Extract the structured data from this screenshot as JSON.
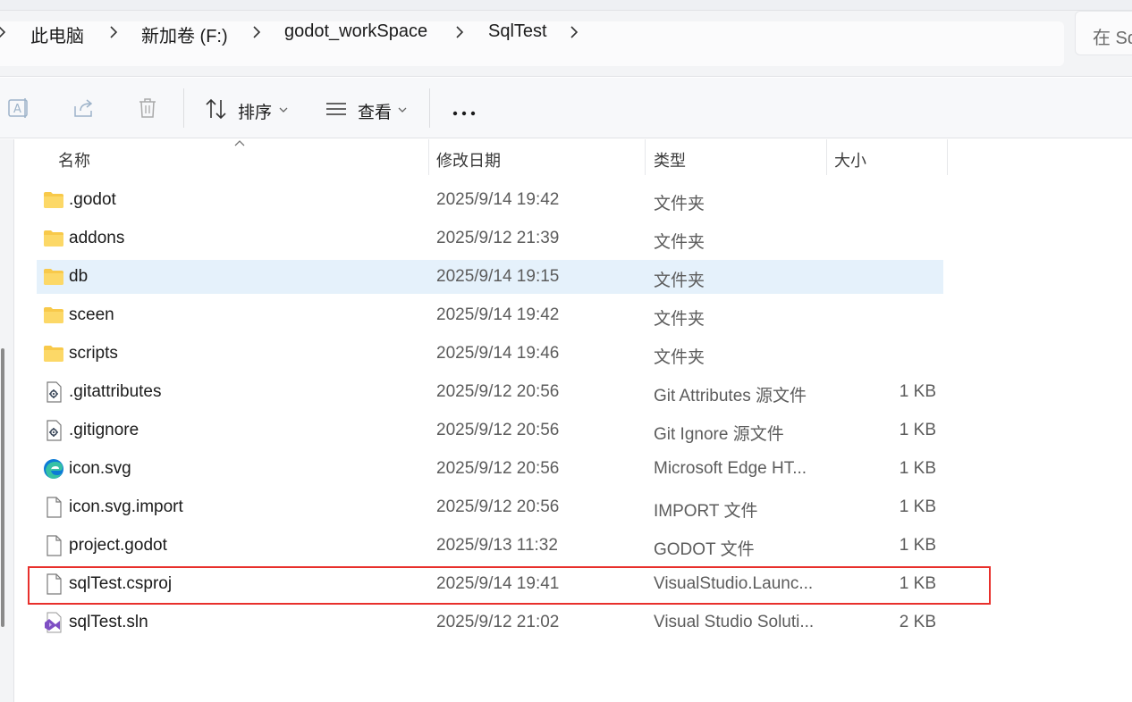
{
  "breadcrumb": {
    "items": [
      "此电脑",
      "新加卷 (F:)",
      "godot_workSpace",
      "SqlTest"
    ],
    "search_placeholder": "在 Sq"
  },
  "toolbar": {
    "sort_label": "排序",
    "view_label": "查看"
  },
  "columns": {
    "name": "名称",
    "date": "修改日期",
    "type": "类型",
    "size": "大小"
  },
  "files": [
    {
      "name": ".godot",
      "date": "2025/9/14 19:42",
      "type": "文件夹",
      "size": "",
      "icon": "folder-icon"
    },
    {
      "name": "addons",
      "date": "2025/9/12 21:39",
      "type": "文件夹",
      "size": "",
      "icon": "folder-icon"
    },
    {
      "name": "db",
      "date": "2025/9/14 19:15",
      "type": "文件夹",
      "size": "",
      "icon": "folder-icon",
      "selected": true
    },
    {
      "name": "sceen",
      "date": "2025/9/14 19:42",
      "type": "文件夹",
      "size": "",
      "icon": "folder-icon"
    },
    {
      "name": "scripts",
      "date": "2025/9/14 19:46",
      "type": "文件夹",
      "size": "",
      "icon": "folder-icon"
    },
    {
      "name": ".gitattributes",
      "date": "2025/9/12 20:56",
      "type": "Git Attributes 源文件",
      "size": "1 KB",
      "icon": "config-file-icon"
    },
    {
      "name": ".gitignore",
      "date": "2025/9/12 20:56",
      "type": "Git Ignore 源文件",
      "size": "1 KB",
      "icon": "config-file-icon"
    },
    {
      "name": "icon.svg",
      "date": "2025/9/12 20:56",
      "type": "Microsoft Edge HT...",
      "size": "1 KB",
      "icon": "edge-icon"
    },
    {
      "name": "icon.svg.import",
      "date": "2025/9/12 20:56",
      "type": "IMPORT 文件",
      "size": "1 KB",
      "icon": "file-icon"
    },
    {
      "name": "project.godot",
      "date": "2025/9/13 11:32",
      "type": "GODOT 文件",
      "size": "1 KB",
      "icon": "file-icon"
    },
    {
      "name": "sqlTest.csproj",
      "date": "2025/9/14 19:41",
      "type": "VisualStudio.Launc...",
      "size": "1 KB",
      "icon": "file-icon",
      "highlighted": true
    },
    {
      "name": "sqlTest.sln",
      "date": "2025/9/12 21:02",
      "type": "Visual Studio Soluti...",
      "size": "2 KB",
      "icon": "visual-studio-icon"
    }
  ],
  "colors": {
    "highlight_border": "#e8302c",
    "selected_row": "#e5f1fb",
    "folder": "#f8c94a"
  }
}
